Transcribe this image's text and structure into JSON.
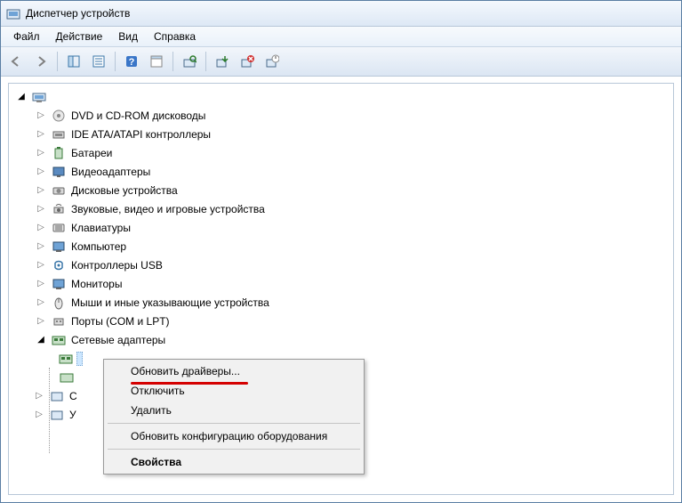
{
  "window": {
    "title": "Диспетчер устройств"
  },
  "menu": {
    "file": "Файл",
    "action": "Действие",
    "view": "Вид",
    "help": "Справка"
  },
  "tree": {
    "root": "",
    "items": [
      "DVD и CD-ROM дисководы",
      "IDE ATA/ATAPI контроллеры",
      "Батареи",
      "Видеоадаптеры",
      "Дисковые устройства",
      "Звуковые, видео и игровые устройства",
      "Клавиатуры",
      "Компьютер",
      "Контроллеры USB",
      "Мониторы",
      "Мыши и иные указывающие устройства",
      "Порты (COM и LPT)",
      "Сетевые адаптеры"
    ],
    "selected_child": "",
    "trailing": [
      "С",
      "У"
    ]
  },
  "context_menu": {
    "update": "Обновить драйверы...",
    "disable": "Отключить",
    "remove": "Удалить",
    "rescan": "Обновить конфигурацию оборудования",
    "props": "Свойства"
  }
}
